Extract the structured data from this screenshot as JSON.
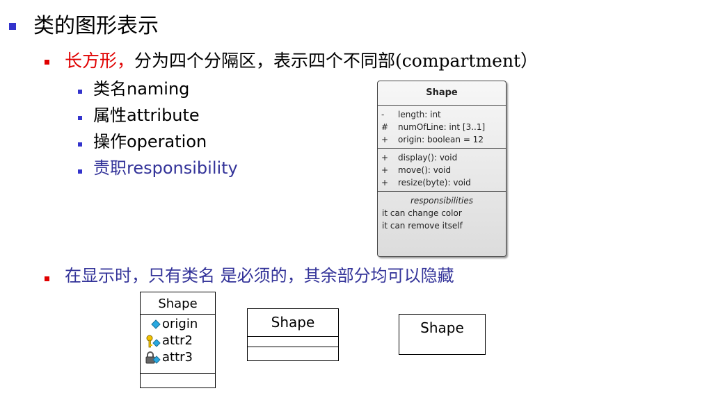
{
  "slide": {
    "heading": "类的图形表示",
    "level2": {
      "rect_label": "长方形，",
      "rect_desc": "分为四个分隔区，表示四个不同部",
      "rect_paren": "(compartment）"
    },
    "compartments": [
      {
        "cn": "类名",
        "en": "naming",
        "color": "#000000"
      },
      {
        "cn": "属性",
        "en": "attribute",
        "color": "#000000"
      },
      {
        "cn": "操作",
        "en": "operation",
        "color": "#000000"
      },
      {
        "cn": "责职",
        "en": "responsibility",
        "color": "#333399"
      }
    ],
    "note": "在显示时，只有类名 是必须的，其余部分均可以隐藏"
  },
  "uml_class": {
    "name": "Shape",
    "attributes": [
      {
        "vis": "-",
        "text": "length: int"
      },
      {
        "vis": "#",
        "text": "numOfLine: int [3..1]"
      },
      {
        "vis": "+",
        "text": "origin: boolean = 12"
      }
    ],
    "operations": [
      {
        "vis": "+",
        "text": "display(): void"
      },
      {
        "vis": "+",
        "text": "move(): void"
      },
      {
        "vis": "+",
        "text": "resize(byte): void"
      }
    ],
    "responsibilities_title": "responsibilities",
    "responsibilities": [
      "it can change color",
      "it can remove itself"
    ]
  },
  "mini_classes": {
    "with_attrs": {
      "name": "Shape",
      "attrs": [
        {
          "icon": "public-attribute-icon",
          "label": "origin"
        },
        {
          "icon": "protected-attribute-icon",
          "label": "attr2"
        },
        {
          "icon": "private-attribute-icon",
          "label": "attr3"
        }
      ]
    },
    "empty_compartments": {
      "name": "Shape"
    },
    "name_only": {
      "name": "Shape"
    }
  },
  "colors": {
    "bullet_blue": "#3333cc",
    "bullet_red": "#e00000",
    "accent_red": "#e00000",
    "navy_text": "#333399"
  }
}
